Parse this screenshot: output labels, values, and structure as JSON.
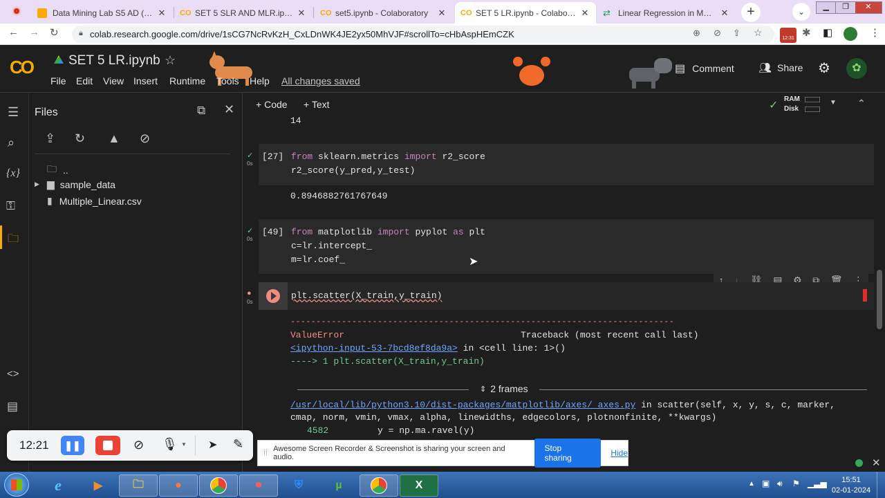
{
  "browser": {
    "tabs": [
      {
        "title": "Data Mining Lab S5 AD (2023",
        "icon_color": "#f9ab00",
        "active": false
      },
      {
        "title": "SET 5 SLR AND MLR.ipynb - C",
        "icon_color": "#f9ab00",
        "active": false
      },
      {
        "title": "set5.ipynb - Colaboratory",
        "icon_color": "#f9ab00",
        "active": false
      },
      {
        "title": "SET 5 LR.ipynb - Colaborator",
        "icon_color": "#f9ab00",
        "active": true
      },
      {
        "title": "Linear Regression in Machine",
        "icon_color": "#0f9d58",
        "active": false
      }
    ],
    "url": "colab.research.google.com/drive/1sCG7NcRvKzH_CxLDnWK4JE2yx50MhVJF#scrollTo=cHbAspHEmCZK",
    "recorder_badge": "12:31"
  },
  "colab": {
    "notebook_title": "SET 5 LR.ipynb",
    "menu": [
      "File",
      "Edit",
      "View",
      "Insert",
      "Runtime",
      "Tools",
      "Help"
    ],
    "save_status": "All changes saved",
    "comment_label": "Comment",
    "share_label": "Share",
    "add_code_label": "Code",
    "add_text_label": "Text",
    "ram_label": "RAM",
    "disk_label": "Disk"
  },
  "sidebar": {
    "title": "Files",
    "items": [
      {
        "name": "..",
        "type": "parent-folder"
      },
      {
        "name": "sample_data",
        "type": "folder"
      },
      {
        "name": "Multiple_Linear.csv",
        "type": "file"
      }
    ]
  },
  "cells": {
    "prev_output": "14",
    "cell27": {
      "exec_count": "[27]",
      "exec_time": "0s",
      "line1": {
        "kw1": "from",
        "mod": " sklearn.metrics ",
        "kw2": "import",
        "name": " r2_score"
      },
      "line2": "r2_score(y_pred,y_test)",
      "output": "0.8946882761767649"
    },
    "cell49": {
      "exec_count": "[49]",
      "exec_time": "0s",
      "line1": {
        "kw1": "from",
        "mod": " matplotlib ",
        "kw2": "import",
        "name": " pyplot ",
        "kw3": "as",
        "alias": " plt"
      },
      "line2": "c=lr.intercept_",
      "line3": "m=lr.coef_"
    },
    "cell53": {
      "exec_time": "0s",
      "code": "plt.scatter(X_train,y_train)",
      "dashes": "---------------------------------------------------------------------------",
      "error_name": "ValueError",
      "traceback": "Traceback (most recent call last)",
      "input_link": "<ipython-input-53-7bcd8ef8da9a>",
      "in_cell": " in <cell line: 1>()",
      "arrow": "----> 1 plt.scatter(X_train,y_train)",
      "frames": "2 frames",
      "path_link": "/usr/local/lib/python3.10/dist-packages/matplotlib/axes/_axes.py",
      "path_in": " in scatter(self, x, y, s, c, marker,",
      "path_cont": "cmap, norm, vmin, vmax, alpha, linewidths, edgecolors, plotnonfinite, **kwargs)",
      "line_no": "4582",
      "line_code": "y = np.ma.ravel(y)"
    }
  },
  "recorder": {
    "time": "12:21",
    "share_msg": "Awesome Screen Recorder & Screenshot is sharing your screen and audio.",
    "stop_label": "Stop sharing",
    "hide_label": "Hide"
  },
  "taskbar": {
    "time": "15:51",
    "date": "02-01-2024"
  }
}
